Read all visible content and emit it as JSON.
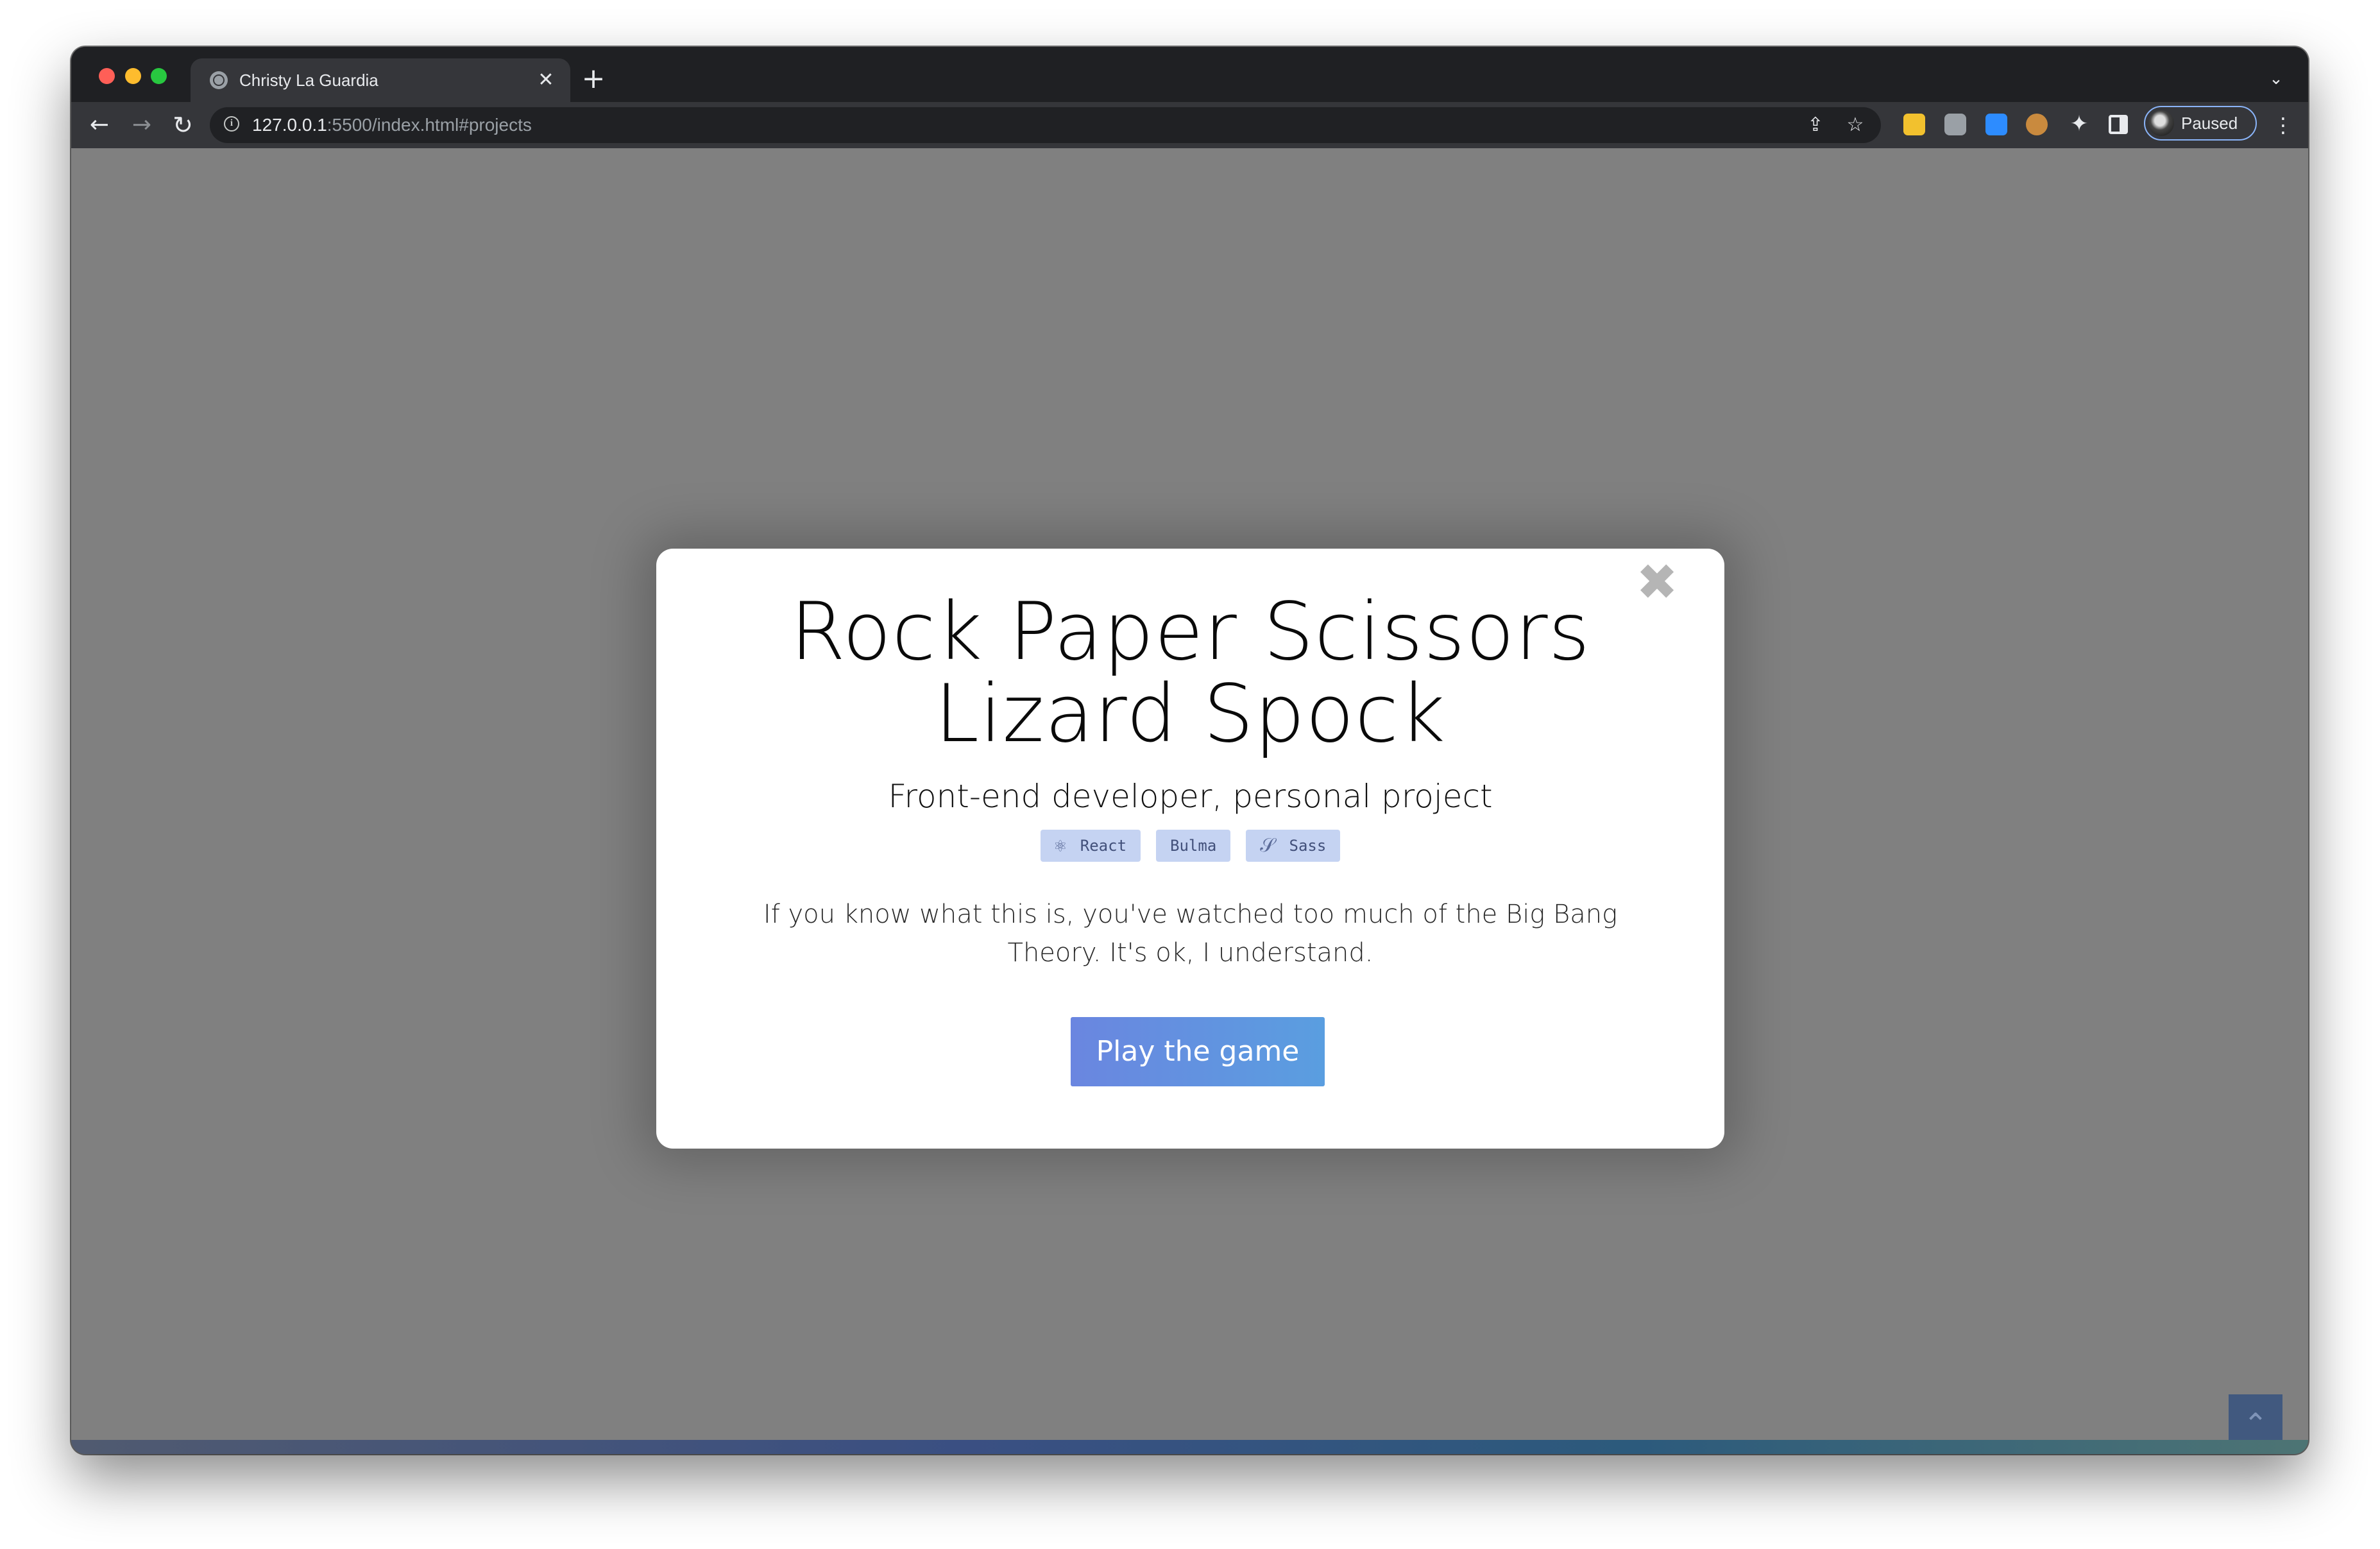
{
  "browser": {
    "tab": {
      "title": "Christy La Guardia",
      "favicon": "globe-icon",
      "close_icon": "✕"
    },
    "new_tab_icon": "+",
    "tab_search_icon": "⌄",
    "nav": {
      "back_icon": "←",
      "forward_icon": "→",
      "reload_icon": "↻"
    },
    "omnibox": {
      "info_icon": "i",
      "url_host": "127.0.0.1",
      "url_rest": ":5500/index.html#projects",
      "share_icon": "⇪",
      "star_icon": "☆"
    },
    "extensions": [
      "sticky-notes-icon",
      "camera-icon",
      "zoom-icon",
      "cookie-icon"
    ],
    "puzzle_icon": "✦",
    "profile": {
      "status": "Paused"
    },
    "menu_icon": "⋮"
  },
  "modal": {
    "close_icon": "✖",
    "title": "Rock Paper Scissors Lizard Spock",
    "subtitle": "Front-end developer, personal project",
    "tags": [
      {
        "label": "React",
        "icon": "⚛"
      },
      {
        "label": "Bulma"
      },
      {
        "label": "Sass",
        "icon": "𝒮"
      }
    ],
    "description": "If you know what this is, you've watched too much of the Big Bang Theory. It's ok, I understand.",
    "button_label": "Play the game"
  },
  "page": {
    "scroll_top_icon": "⌃"
  },
  "colors": {
    "overlay": "#808080",
    "button_gradient_start": "#6a86e0",
    "button_gradient_end": "#5a9ee0",
    "tag_background": "#c5d3f2",
    "tag_text": "#42507a",
    "profile_outline": "#8ab4f8"
  }
}
